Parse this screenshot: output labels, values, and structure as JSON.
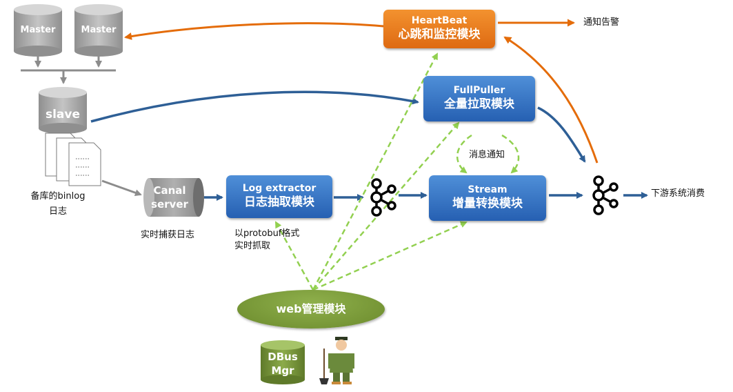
{
  "nodes": {
    "master1": "Master",
    "master2": "Master",
    "slave": "slave",
    "canal_line1": "Canal",
    "canal_line2": "server",
    "log_extractor_line1": "Log extractor",
    "log_extractor_line2": "日志抽取模块",
    "stream_line1": "Stream",
    "stream_line2": "增量转换模块",
    "fullpuller_line1": "FullPuller",
    "fullpuller_line2": "全量拉取模块",
    "heartbeat_line1": "HeartBeat",
    "heartbeat_line2": "心跳和监控模块",
    "web": "web管理模块",
    "dbus_line1": "DBus",
    "dbus_line2": "Mgr"
  },
  "labels": {
    "binlog_line1": "备库的binlog",
    "binlog_line2": "日志",
    "realtime_capture": "实时捕获日志",
    "protobuf_line1": "以protobuf格式",
    "protobuf_line2": "实时抓取",
    "message_notify": "消息通知",
    "alert_notify": "通知告警",
    "downstream": "下游系统消费"
  },
  "colors": {
    "blue_box": "#2f6fc4",
    "orange_box": "#ee7d22",
    "gray_db": "#a6a6a6",
    "green_web": "#76923c",
    "blue_arrow": "#2e5f96",
    "orange_arrow": "#e46c0a",
    "green_dashed": "#92d050"
  },
  "icons": [
    "document-stack-icon",
    "kafka-icon",
    "kafka-icon",
    "admin-person-icon"
  ]
}
